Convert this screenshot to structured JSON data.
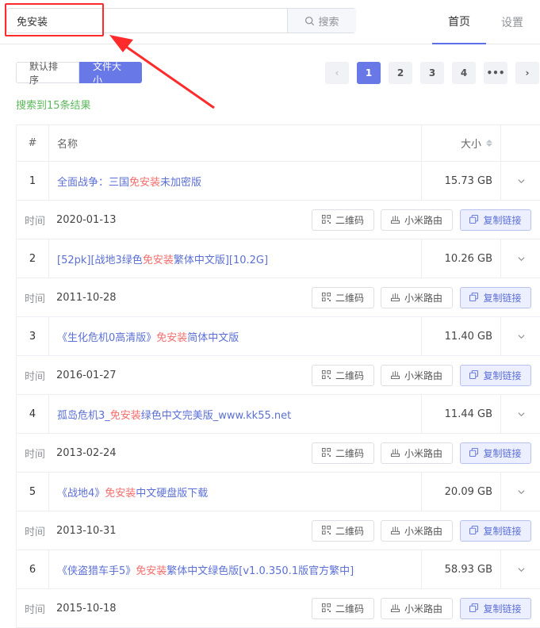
{
  "search": {
    "value": "免安装",
    "button_label": "搜索"
  },
  "nav": {
    "home": "首页",
    "settings": "设置"
  },
  "sort": {
    "default_label": "默认排序",
    "size_label": "文件大小"
  },
  "pagination": {
    "prev": "‹",
    "pages": [
      "1",
      "2",
      "3",
      "4"
    ],
    "more": "•••",
    "next": "›",
    "current": "1"
  },
  "result_count": "搜索到15条结果",
  "table": {
    "headers": {
      "index": "#",
      "name": "名称",
      "size": "大小"
    },
    "time_label": "时间",
    "actions": {
      "qr": "二维码",
      "xiaomi": "小米路由",
      "copy": "复制链接"
    },
    "rows": [
      {
        "index": "1",
        "name_pre": "全面战争：三国",
        "name_hl": "免安装",
        "name_post": "未加密版",
        "size": "15.73 GB",
        "date": "2020-01-13"
      },
      {
        "index": "2",
        "name_pre": "[52pk][战地3绿色",
        "name_hl": "免安装",
        "name_post": "繁体中文版][10.2G]",
        "size": "10.26 GB",
        "date": "2011-10-28"
      },
      {
        "index": "3",
        "name_pre": "《生化危机0高清版》",
        "name_hl": "免安装",
        "name_post": "简体中文版",
        "size": "11.40 GB",
        "date": "2016-01-27"
      },
      {
        "index": "4",
        "name_pre": "孤岛危机3_",
        "name_hl": "免安装",
        "name_post": "绿色中文完美版_www.kk55.net",
        "size": "11.44 GB",
        "date": "2013-02-24"
      },
      {
        "index": "5",
        "name_pre": "《战地4》",
        "name_hl": "免安装",
        "name_post": "中文硬盘版下载",
        "size": "20.09 GB",
        "date": "2013-10-31"
      },
      {
        "index": "6",
        "name_pre": "《侠盗猎车手5》",
        "name_hl": "免安装",
        "name_post": "繁体中文绿色版[v1.0.350.1版官方繁中]",
        "size": "58.93 GB",
        "date": "2015-10-18"
      }
    ]
  },
  "colors": {
    "accent": "#6878e6",
    "link": "#5b6fd6",
    "highlight": "#f56c6c",
    "success": "#5cb85c",
    "annotation": "#ff2b2b"
  }
}
